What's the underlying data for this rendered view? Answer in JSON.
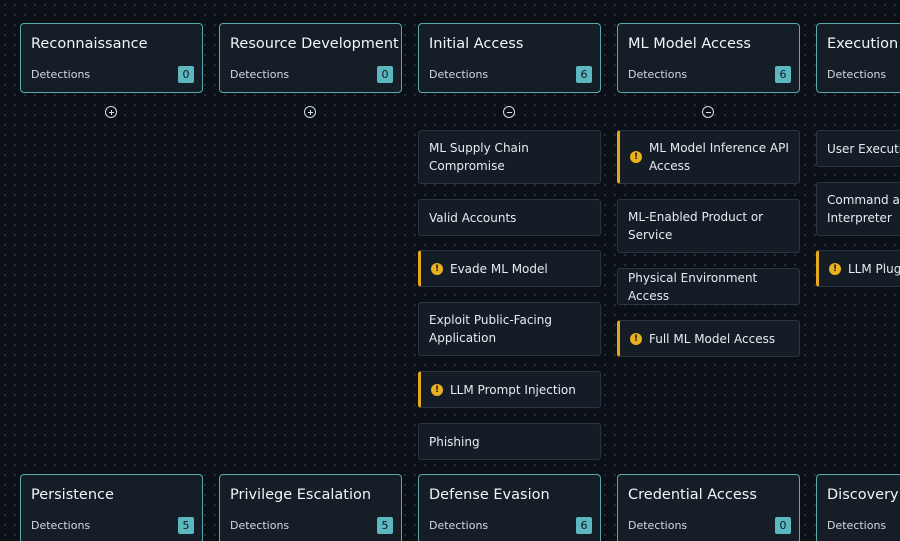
{
  "detections_label": "Detections",
  "tactics_top": [
    {
      "name": "Reconnaissance",
      "count": "0",
      "toggle": "plus"
    },
    {
      "name": "Resource Development",
      "count": "0",
      "toggle": "plus"
    },
    {
      "name": "Initial Access",
      "count": "6",
      "toggle": "minus"
    },
    {
      "name": "ML Model Access",
      "count": "6",
      "toggle": "minus"
    },
    {
      "name": "Execution",
      "count": ""
    }
  ],
  "tactics_bottom": [
    {
      "name": "Persistence",
      "count": "5"
    },
    {
      "name": "Privilege Escalation",
      "count": "5"
    },
    {
      "name": "Defense Evasion",
      "count": "6"
    },
    {
      "name": "Credential Access",
      "count": "0"
    },
    {
      "name": "Discovery",
      "count": ""
    }
  ],
  "techniques": {
    "initial_access": [
      {
        "label": "ML Supply Chain Compromise",
        "warn": false
      },
      {
        "label": "Valid Accounts",
        "warn": false
      },
      {
        "label": "Evade ML Model",
        "warn": true
      },
      {
        "label": "Exploit Public-Facing Application",
        "warn": false
      },
      {
        "label": "LLM Prompt Injection",
        "warn": true
      },
      {
        "label": "Phishing",
        "warn": false
      }
    ],
    "ml_model_access": [
      {
        "label": "ML Model Inference API Access",
        "warn": true
      },
      {
        "label": "ML-Enabled Product or Service",
        "warn": false
      },
      {
        "label": "Physical Environment Access",
        "warn": false
      },
      {
        "label": "Full ML Model Access",
        "warn": true
      }
    ],
    "execution": [
      {
        "label": "User Execution",
        "warn": false
      },
      {
        "label": "Command and Scripting Interpreter",
        "warn": false
      },
      {
        "label": "LLM Plugin Compromise",
        "warn": true
      }
    ]
  },
  "icons": {
    "expand": "plus-circle-icon",
    "collapse": "minus-circle-icon",
    "warning": "warning-icon"
  },
  "colors": {
    "background": "#0b0f16",
    "card_border": "#5aa9ad",
    "count_badge": "#5cb7bf",
    "warning": "#e3a81d"
  }
}
